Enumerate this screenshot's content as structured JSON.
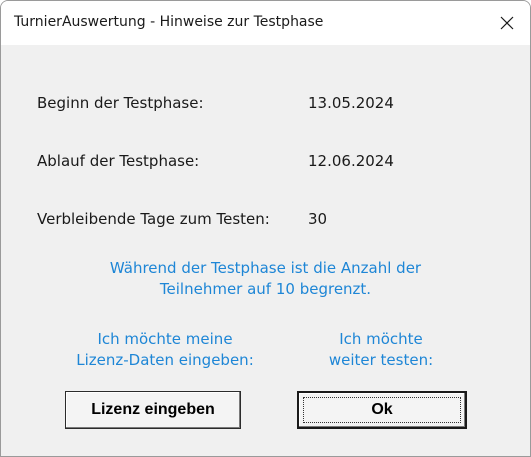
{
  "window": {
    "title": "TurnierAuswertung - Hinweise zur Testphase",
    "close_icon": "close-icon"
  },
  "details": {
    "start_label": "Beginn der Testphase:",
    "start_value": "13.05.2024",
    "end_label": "Ablauf der Testphase:",
    "end_value": "12.06.2024",
    "remaining_label": "Verbleibende Tage zum Testen:",
    "remaining_value": "30"
  },
  "notice": {
    "line1": "Während der Testphase ist die Anzahl der",
    "line2": "Teilnehmer auf 10 begrenzt."
  },
  "license": {
    "hint_line1": "Ich möchte meine",
    "hint_line2": "Lizenz-Daten eingeben:",
    "button_label": "Lizenz eingeben"
  },
  "continue": {
    "hint_line1": "Ich möchte",
    "hint_line2": "weiter testen:",
    "button_label": "Ok"
  },
  "colors": {
    "accent_text": "#1e86d6",
    "dialog_bg": "#f0f0f0"
  }
}
